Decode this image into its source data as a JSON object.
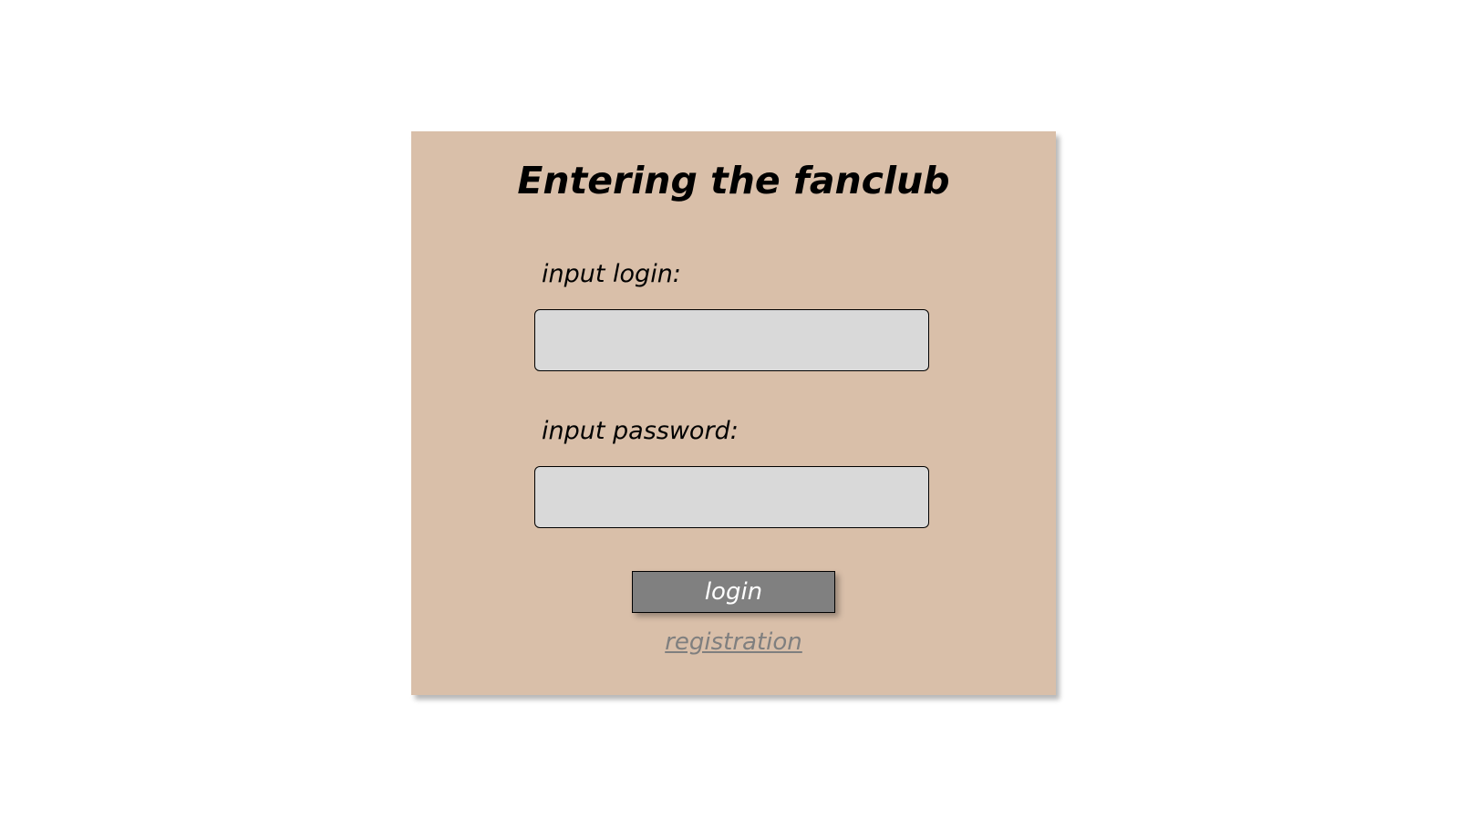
{
  "form": {
    "title": "Entering the fanclub",
    "login_label": "input login:",
    "login_value": "",
    "password_label": "input password:",
    "password_value": "",
    "login_button_label": "login",
    "registration_link_label": "registration"
  },
  "colors": {
    "page_background": "#ffffff",
    "card_background": "#d9bfa9",
    "input_background": "#d9d9d9",
    "button_background": "#808080",
    "button_text": "#ffffff",
    "link_text": "#7f7f7f"
  }
}
